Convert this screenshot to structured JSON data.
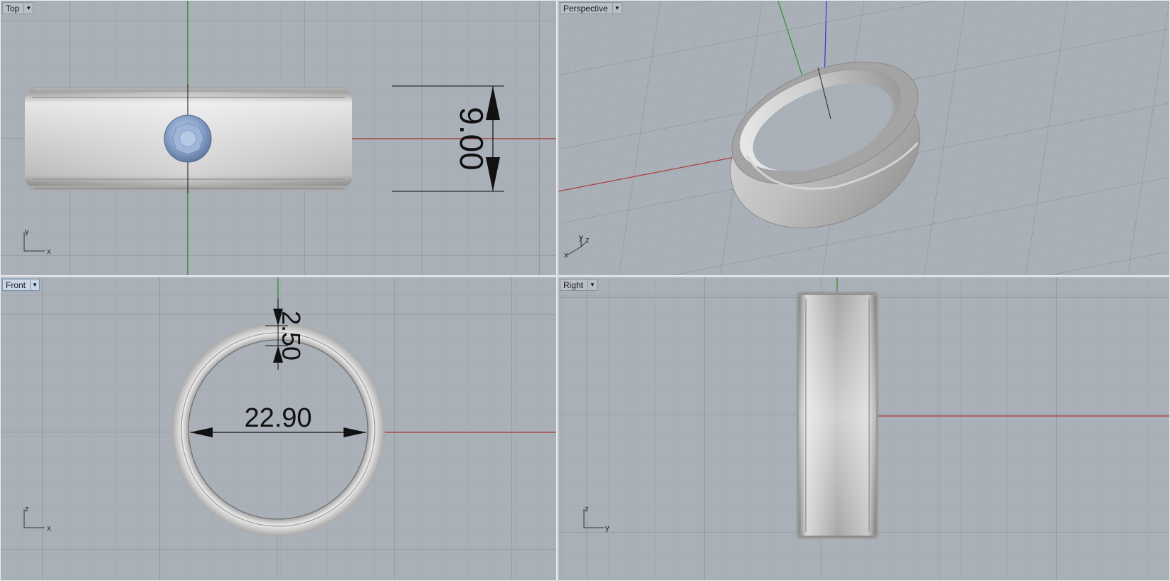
{
  "viewports": {
    "top": {
      "label": "Top",
      "axis_x": "x",
      "axis_y": "y",
      "dimension": "9.00"
    },
    "perspective": {
      "label": "Perspective",
      "axis_x": "x",
      "axis_y": "y",
      "axis_z": "z"
    },
    "front": {
      "label": "Front",
      "axis_x": "x",
      "axis_z": "z",
      "dimension_thickness": "2.50",
      "dimension_diameter": "22.90"
    },
    "right": {
      "label": "Right",
      "axis_y": "y",
      "axis_z": "z"
    }
  },
  "colors": {
    "viewport_bg": "#a9b0b8",
    "grid_minor": "#9fa6ae",
    "grid_major": "#8f969f",
    "axis_x": "#b13a3a",
    "axis_y": "#2f8f2f",
    "axis_z": "#2a3fc4",
    "gem": "#8aa3cc",
    "metal": "#c9c9c9"
  },
  "icons": {
    "viewport_menu": "triangle-down-icon"
  }
}
